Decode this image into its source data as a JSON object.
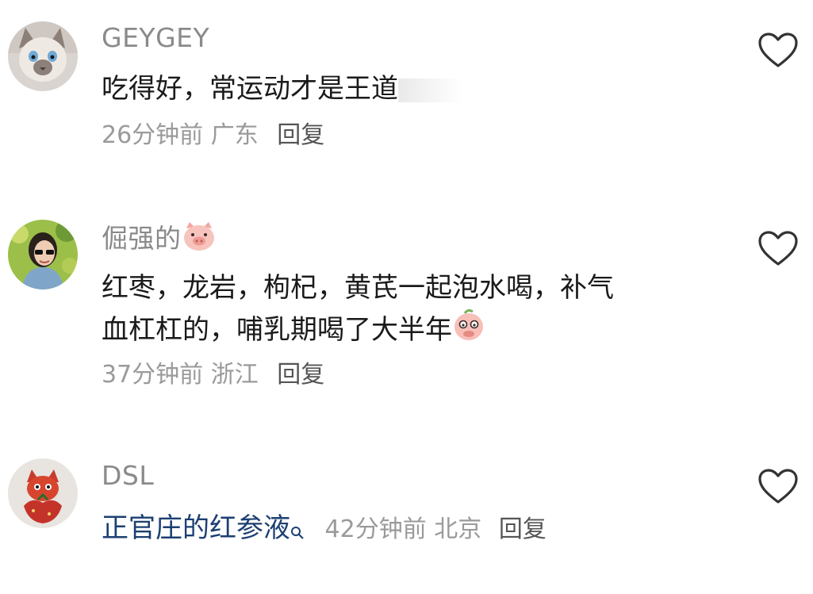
{
  "comments": [
    {
      "username": "GEYGEY",
      "text": "吃得好，常运动才是王道",
      "time": "26分钟前",
      "location": "广东",
      "reply_label": "回复",
      "avatar_icon": "siamese-kitten-avatar",
      "like_icon": "heart-outline-icon"
    },
    {
      "username": "倔强的",
      "username_emoji": "pig-face-emoji",
      "text_line1": "红枣，龙岩，枸杞，黄芪一起泡水喝，补气",
      "text_line2": "血杠杠的，哺乳期喝了大半年",
      "text_emoji": "pink-face-emoji",
      "time": "37分钟前",
      "location": "浙江",
      "reply_label": "回复",
      "avatar_icon": "woman-sunglasses-avatar",
      "like_icon": "heart-outline-icon"
    },
    {
      "username": "DSL",
      "link_text": "正官庄的红参液",
      "link_icon": "search-icon",
      "time": "42分钟前",
      "location": "北京",
      "reply_label": "回复",
      "avatar_icon": "red-character-avatar",
      "like_icon": "heart-outline-icon"
    }
  ],
  "colors": {
    "background": "#ffffff",
    "username": "#8a8a8a",
    "text": "#1a1a1a",
    "meta": "#9a9a9a",
    "link": "#1c3f72"
  }
}
